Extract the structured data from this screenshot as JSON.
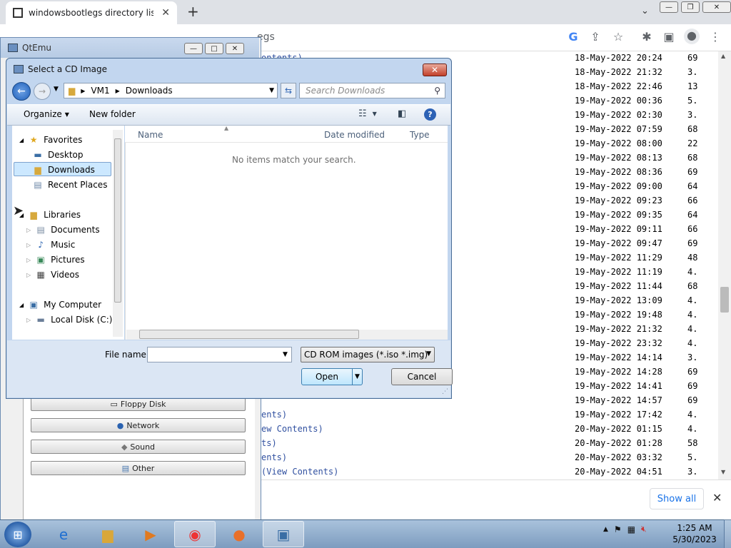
{
  "chrome": {
    "tab_title": "windowsbootlegs directory listing",
    "tab_close": "✕",
    "new_tab": "+",
    "tab_search": "⌄",
    "omnibox": "egs",
    "icons": [
      "google-icon",
      "share-icon",
      "star-icon",
      "extensions-icon",
      "sidepanel-icon",
      "profile-icon",
      "menu-icon"
    ]
  },
  "listing": {
    "rows": [
      {
        "name": "ontents)",
        "date": "18-May-2022 20:24",
        "size": "69"
      },
      {
        "name": "",
        "date": "18-May-2022 21:32",
        "size": "3."
      },
      {
        "name": "",
        "date": "18-May-2022 22:46",
        "size": "13"
      },
      {
        "name": "",
        "date": "19-May-2022 00:36",
        "size": "5."
      },
      {
        "name": "",
        "date": "19-May-2022 02:30",
        "size": "3."
      },
      {
        "name": "",
        "date": "19-May-2022 07:59",
        "size": "68"
      },
      {
        "name": "",
        "date": "19-May-2022 08:00",
        "size": "22"
      },
      {
        "name": "",
        "date": "19-May-2022 08:13",
        "size": "68"
      },
      {
        "name": "",
        "date": "19-May-2022 08:36",
        "size": "69"
      },
      {
        "name": "",
        "date": "19-May-2022 09:00",
        "size": "64"
      },
      {
        "name": "",
        "date": "19-May-2022 09:23",
        "size": "66"
      },
      {
        "name": "",
        "date": "19-May-2022 09:35",
        "size": "64"
      },
      {
        "name": "",
        "date": "19-May-2022 09:11",
        "size": "66"
      },
      {
        "name": "",
        "date": "19-May-2022 09:47",
        "size": "69"
      },
      {
        "name": "",
        "date": "19-May-2022 11:29",
        "size": "48"
      },
      {
        "name": "",
        "date": "19-May-2022 11:19",
        "size": "4."
      },
      {
        "name": "",
        "date": "19-May-2022 11:44",
        "size": "68"
      },
      {
        "name": "",
        "date": "19-May-2022 13:09",
        "size": "4."
      },
      {
        "name": "",
        "date": "19-May-2022 19:48",
        "size": "4."
      },
      {
        "name": "",
        "date": "19-May-2022 21:32",
        "size": "4."
      },
      {
        "name": "",
        "date": "19-May-2022 23:32",
        "size": "4."
      },
      {
        "name": "",
        "date": "19-May-2022 14:14",
        "size": "3."
      },
      {
        "name": "",
        "date": "19-May-2022 14:28",
        "size": "69"
      },
      {
        "name": "",
        "date": "19-May-2022 14:41",
        "size": "69"
      },
      {
        "name": "",
        "date": "19-May-2022 14:57",
        "size": "69"
      },
      {
        "name": "ents)",
        "date": "19-May-2022 17:42",
        "size": "4."
      },
      {
        "name": "ew Contents)",
        "date": "20-May-2022 01:15",
        "size": "4."
      },
      {
        "name": "ts)",
        "date": "20-May-2022 01:28",
        "size": "58"
      },
      {
        "name": "ents)",
        "date": "20-May-2022 03:32",
        "size": "5."
      },
      {
        "name": "(View Contents)",
        "date": "20-May-2022 04:51",
        "size": "3."
      }
    ]
  },
  "download_bar": {
    "show_all": "Show all",
    "close": "✕"
  },
  "qtemu": {
    "title": "QtEmu",
    "buttons": [
      {
        "label": "Floppy Disk",
        "icon": "floppy-icon"
      },
      {
        "label": "Network",
        "icon": "network-icon"
      },
      {
        "label": "Sound",
        "icon": "sound-icon"
      },
      {
        "label": "Other",
        "icon": "other-icon"
      }
    ]
  },
  "dialog": {
    "title": "Select a CD Image",
    "close": "✕",
    "breadcrumb": [
      "VM1",
      "Downloads"
    ],
    "search_placeholder": "Search Downloads",
    "organize": "Organize",
    "new_folder": "New folder",
    "nav": {
      "favorites": "Favorites",
      "desktop": "Desktop",
      "downloads": "Downloads",
      "recent": "Recent Places",
      "libraries": "Libraries",
      "documents": "Documents",
      "music": "Music",
      "pictures": "Pictures",
      "videos": "Videos",
      "computer": "My Computer",
      "local_disk": "Local Disk (C:)"
    },
    "columns": {
      "name": "Name",
      "date": "Date modified",
      "type": "Type"
    },
    "empty_message": "No items match your search.",
    "file_name_label": "File name:",
    "file_name_value": "",
    "filter": "CD ROM images (*.iso *.img)",
    "open": "Open",
    "cancel": "Cancel"
  },
  "taskbar": {
    "apps": [
      "explorer-ie-icon",
      "file-explorer-icon",
      "media-player-icon",
      "chrome-icon",
      "firefox-icon",
      "qtemu-icon"
    ],
    "time": "1:25 AM",
    "date": "5/30/2023"
  }
}
